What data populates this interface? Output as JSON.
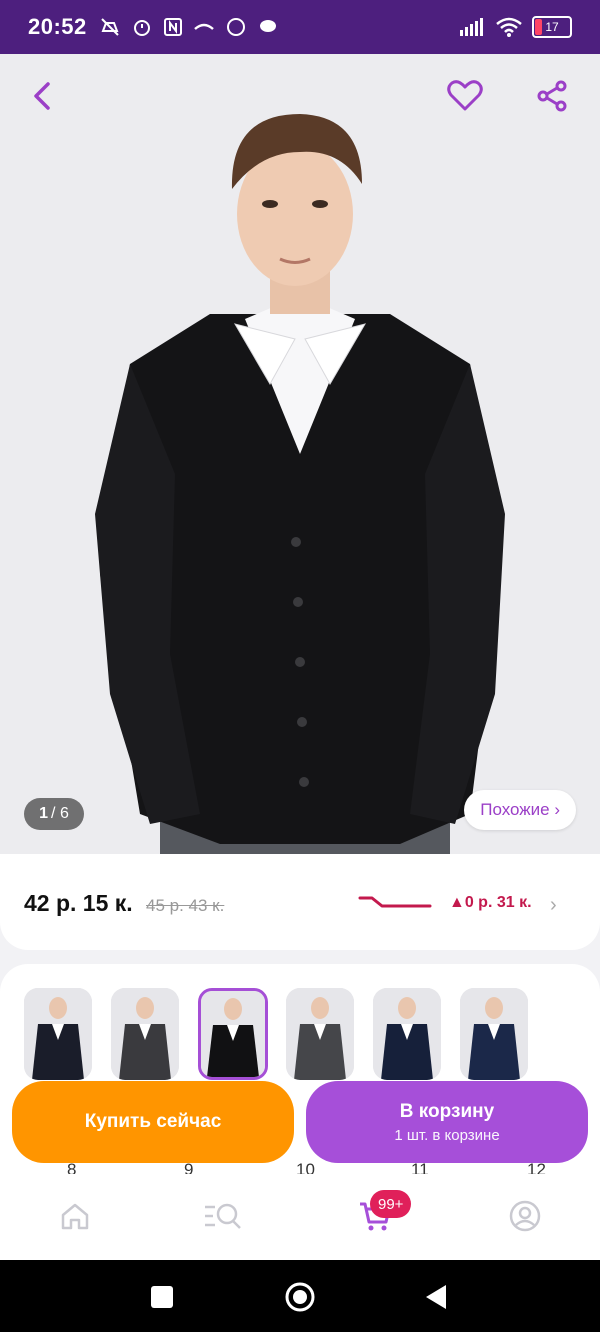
{
  "status": {
    "time": "20:52",
    "battery": "17"
  },
  "gallery": {
    "counter_current": "1",
    "counter_total": "/ 6",
    "similar_label": "Похожие ›"
  },
  "price": {
    "current": "42 р. 15 к.",
    "old": "45 р. 43 к.",
    "delta": "▲0 р. 31 к."
  },
  "sizes": [
    "8",
    "9",
    "10",
    "11",
    "12"
  ],
  "actions": {
    "buy_now": "Купить сейчас",
    "to_cart": "В корзину",
    "cart_sub": "1 шт. в корзине"
  },
  "nav": {
    "cart_badge": "99+"
  },
  "colors": {
    "accent": "#a64fd9",
    "orange": "#ff9500",
    "statusbar": "#4d1f7e",
    "price_delta": "#c3194d"
  },
  "icons": [
    "back-icon",
    "heart-icon",
    "share-icon",
    "home-icon",
    "catalog-search-icon",
    "cart-icon",
    "profile-icon"
  ]
}
